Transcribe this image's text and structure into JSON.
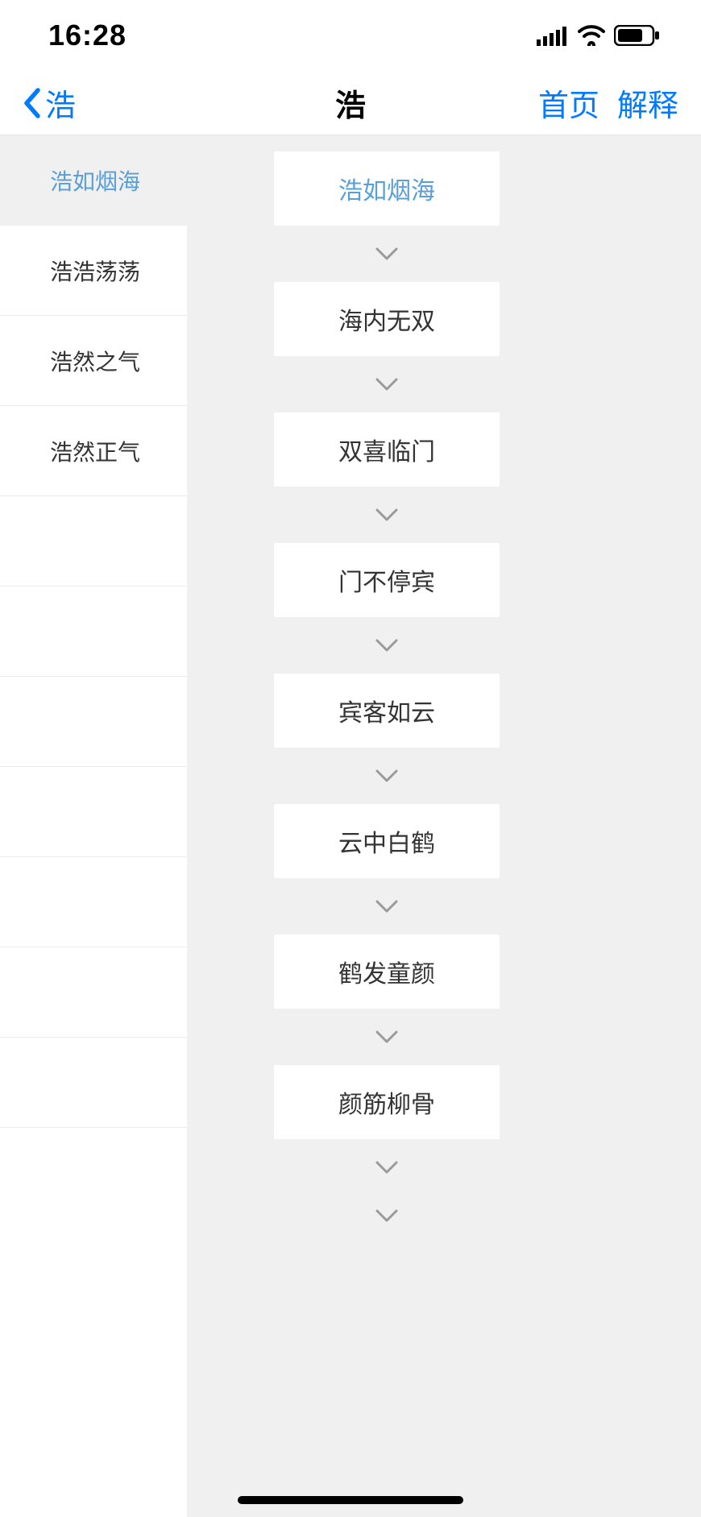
{
  "status": {
    "time": "16:28"
  },
  "nav": {
    "back": "浩",
    "title": "浩",
    "home": "首页",
    "explain": "解释"
  },
  "sidebar": {
    "items": [
      "浩如烟海",
      "浩浩荡荡",
      "浩然之气",
      "浩然正气",
      "",
      "",
      "",
      "",
      "",
      "",
      ""
    ]
  },
  "chain": {
    "items": [
      "浩如烟海",
      "海内无双",
      "双喜临门",
      "门不停宾",
      "宾客如云",
      "云中白鹤",
      "鹤发童颜",
      "颜筋柳骨"
    ]
  }
}
